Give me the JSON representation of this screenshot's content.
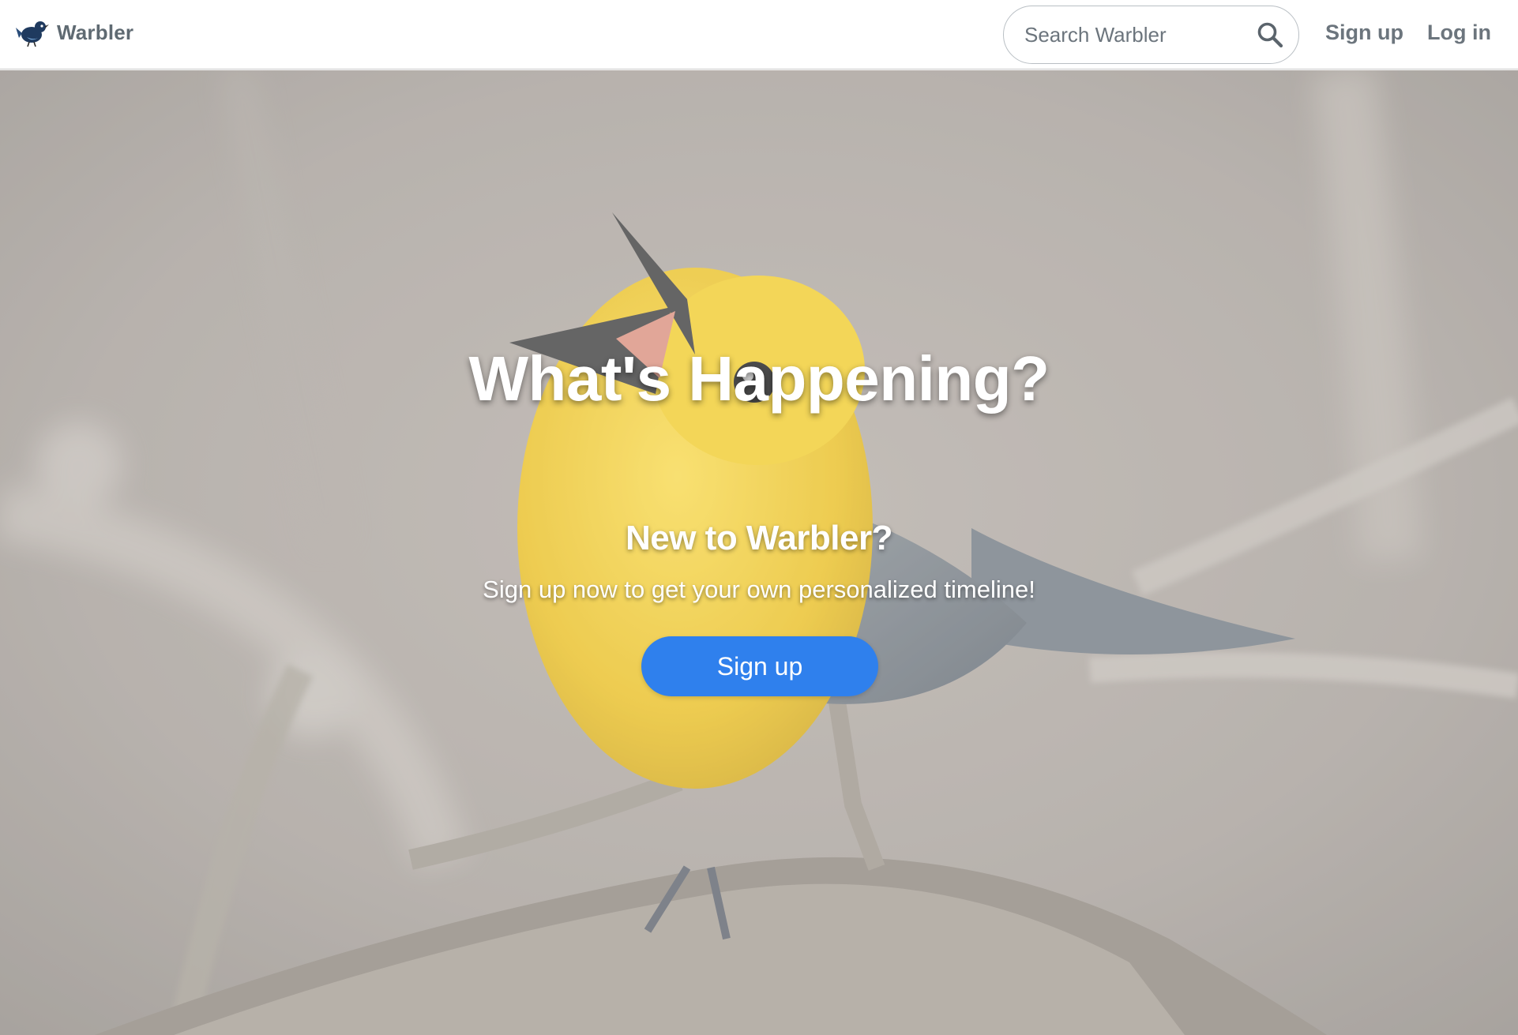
{
  "navbar": {
    "brand_name": "Warbler",
    "logo_icon": "warbler-bird-logo-icon",
    "search": {
      "placeholder": "Search Warbler",
      "value": "",
      "icon": "search-icon"
    },
    "links": {
      "signup": "Sign up",
      "login": "Log in"
    }
  },
  "hero": {
    "title": "What's Happening?",
    "subtitle": "New to Warbler?",
    "text": "Sign up now to get your own personalized timeline!",
    "button_label": "Sign up",
    "background_image": "yellow-warbler-singing-on-branch"
  },
  "colors": {
    "accent": "#2f80ed",
    "nav_text": "#6c757d",
    "brand_text": "#5f6a72"
  }
}
